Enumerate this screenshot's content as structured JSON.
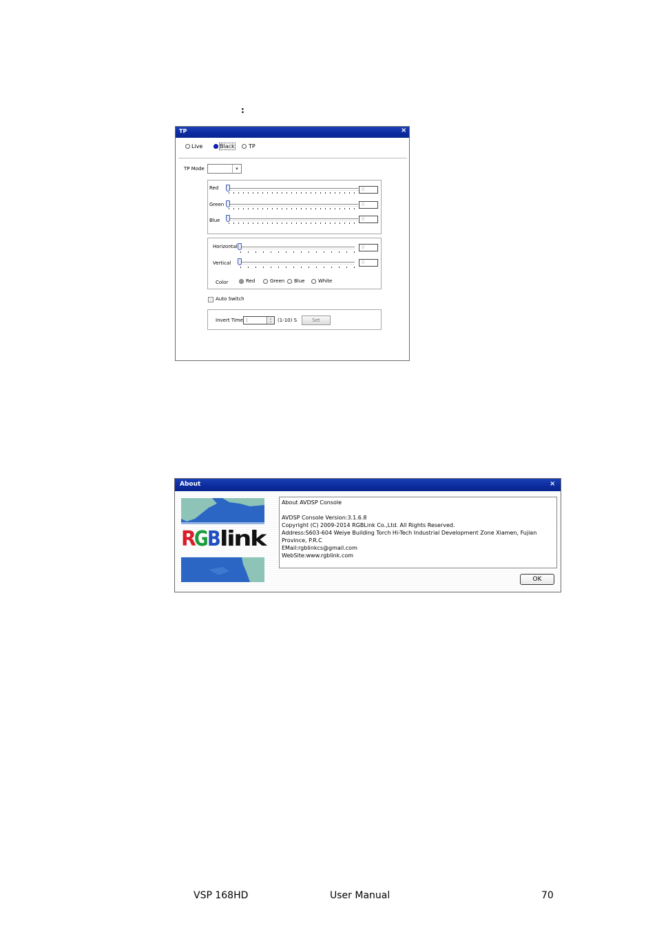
{
  "intro_fragment": ":",
  "tp_dialog": {
    "title": "TP",
    "close": "×",
    "source_options": [
      "Live",
      "Black",
      "TP"
    ],
    "selected_source": "Black",
    "tp_mode_label": "TP Mode",
    "tp_mode_value": "",
    "rgb_sliders": [
      {
        "label": "Red",
        "value": "0"
      },
      {
        "label": "Green",
        "value": "0"
      },
      {
        "label": "Blue",
        "value": "0"
      }
    ],
    "pos_sliders": [
      {
        "label": "Horizontal",
        "value": "0"
      },
      {
        "label": "Vertical",
        "value": "0"
      }
    ],
    "color_label": "Color",
    "color_options": [
      "Red",
      "Green",
      "Blue",
      "White"
    ],
    "auto_switch_label": "Auto Switch",
    "invert_time_label": "Invert Time",
    "invert_time_value": "1",
    "invert_range": "(1-10) S",
    "set_label": "Set"
  },
  "about_dialog": {
    "title": "About",
    "close": "×",
    "logo_text": "RGBlink",
    "lines": [
      "About AVDSP Console",
      "",
      "AVDSP Console  Version:3.1.6.8",
      "Copyright (C) 2009-2014 RGBLink Co.,Ltd. All Rights Reserved.",
      "Address:S603-604 Weiye Building Torch Hi-Tech Industrial Development Zone Xiamen, Fujian",
      "Province, P.R.C",
      "EMail:rgblinkcs@gmail.com",
      "WebSite:www.rgblink.com"
    ],
    "ok_label": "OK"
  },
  "footer": {
    "product": "VSP 168HD",
    "doc": "User Manual",
    "page": "70"
  }
}
